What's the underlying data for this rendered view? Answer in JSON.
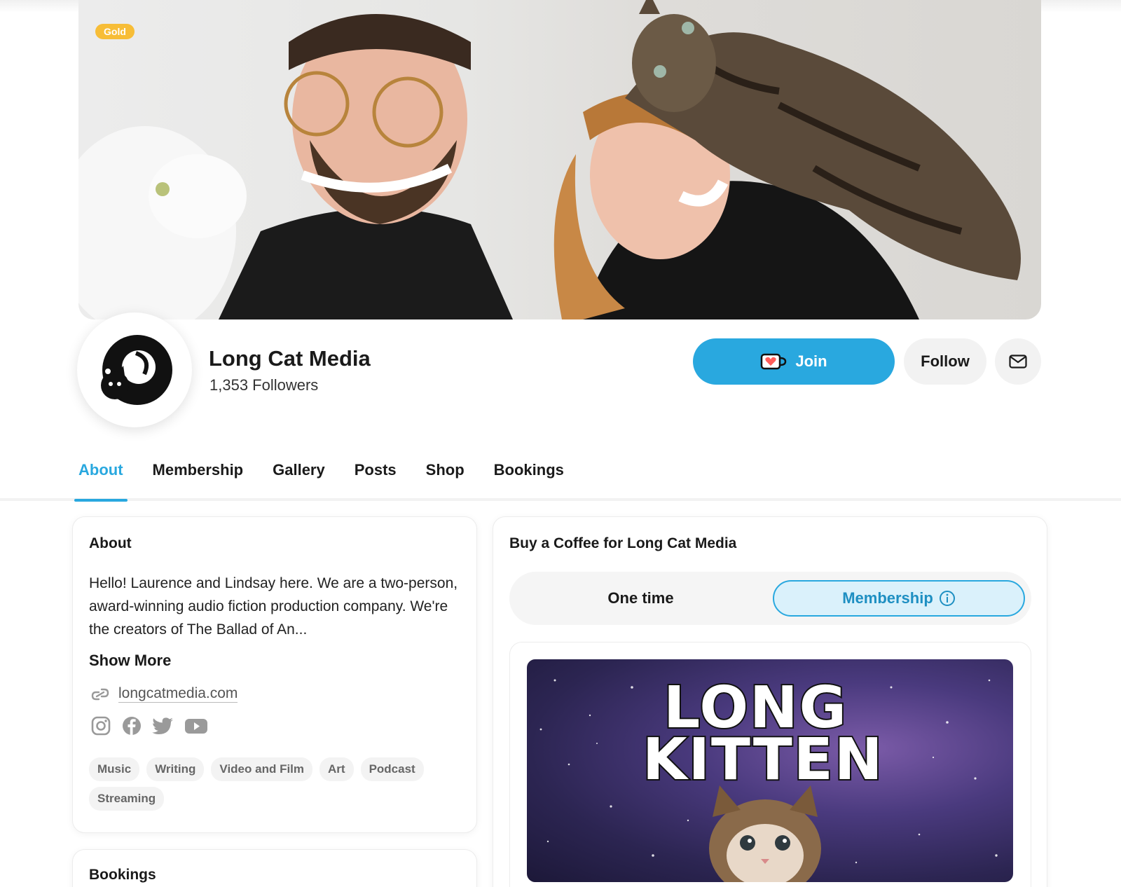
{
  "cover": {
    "badge": "Gold"
  },
  "profile": {
    "name": "Long Cat Media",
    "followers": "1,353 Followers"
  },
  "actions": {
    "join_label": "Join",
    "follow_label": "Follow"
  },
  "tabs": [
    {
      "label": "About",
      "active": true
    },
    {
      "label": "Membership",
      "active": false
    },
    {
      "label": "Gallery",
      "active": false
    },
    {
      "label": "Posts",
      "active": false
    },
    {
      "label": "Shop",
      "active": false
    },
    {
      "label": "Bookings",
      "active": false
    }
  ],
  "about": {
    "title": "About",
    "text": "Hello! Laurence and Lindsay here. We are a two-person, award-winning audio fiction production company. We're the creators of The Ballad of An...",
    "show_more": "Show More",
    "website": "longcatmedia.com",
    "socials": [
      "instagram-icon",
      "facebook-icon",
      "twitter-icon",
      "youtube-icon"
    ],
    "tags": [
      "Music",
      "Writing",
      "Video and Film",
      "Art",
      "Podcast",
      "Streaming"
    ]
  },
  "bookings": {
    "title": "Bookings"
  },
  "coffee": {
    "title": "Buy a Coffee for Long Cat Media",
    "one_time_label": "One time",
    "membership_label": "Membership",
    "tier_image_line1": "LONG",
    "tier_image_line2": "KITTEN"
  },
  "colors": {
    "accent": "#29a8df",
    "gold": "#f7bd37",
    "membership_bg": "#daf1fb"
  }
}
